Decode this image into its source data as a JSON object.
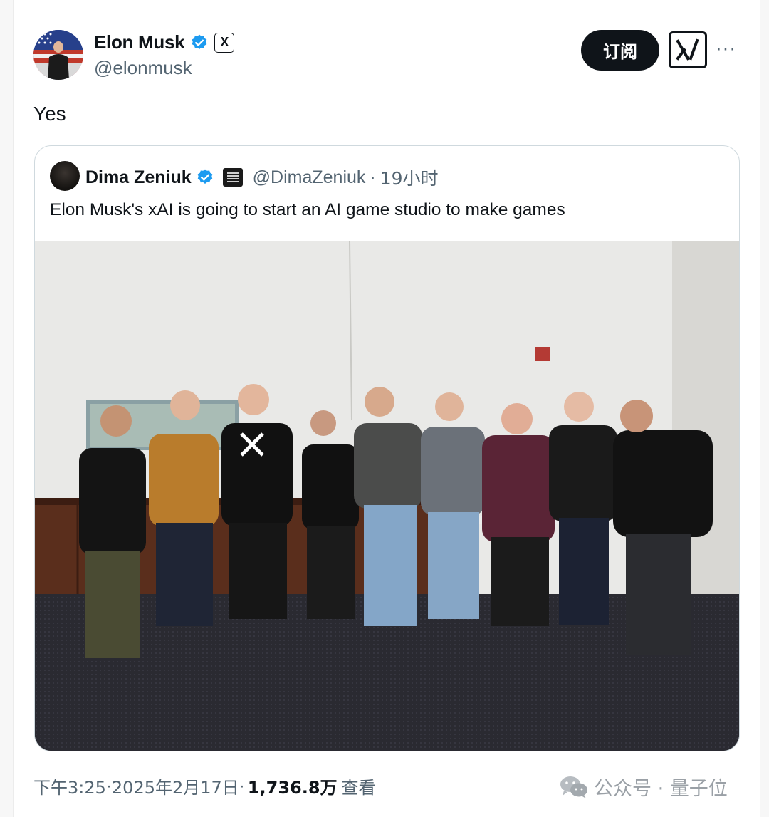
{
  "post": {
    "author_name": "Elon Musk",
    "author_handle": "@elonmusk",
    "affiliate_badge": "X",
    "subscribe_label": "订阅",
    "grok_icon": "xai-logo-icon",
    "more_label": "···",
    "text": "Yes"
  },
  "quoted": {
    "author_name": "Dima Zeniuk",
    "author_handle": "@DimaZeniuk",
    "separator": "·",
    "time_ago": "19小时",
    "text": "Elon Musk's xAI is going to start an AI game studio to make games"
  },
  "footer": {
    "time": "下午3:25",
    "sep1": " · ",
    "date": "2025年2月17日",
    "sep2": " · ",
    "views": "1,736.8万",
    "views_label": "查看"
  },
  "watermark": {
    "brand": "公众号 · 量子位"
  },
  "colors": {
    "verified_blue": "#1d9bf0",
    "text_primary": "#0f1419",
    "text_secondary": "#536471"
  }
}
